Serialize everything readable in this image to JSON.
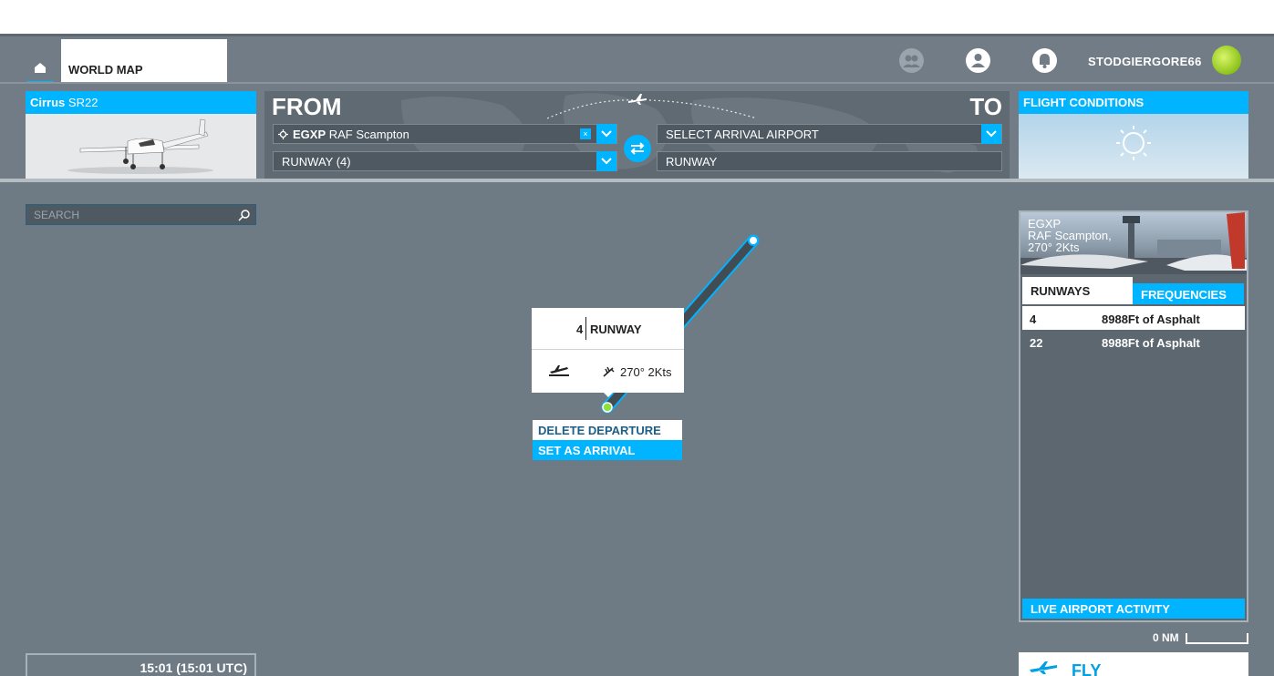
{
  "topbar": {
    "world_map_label": "WORLD MAP",
    "username": "STODGIERGORE66",
    "icons": [
      "home-icon",
      "friends-icon",
      "profile-icon",
      "notifications-icon"
    ]
  },
  "aircraft_card": {
    "name_bold": "Cirrus",
    "name_rest": " SR22"
  },
  "route": {
    "from_label": "FROM",
    "to_label": "TO",
    "departure_icao": "EGXP",
    "departure_name": " RAF Scampton",
    "departure_clear": "×",
    "departure_runway": "RUNWAY (4)",
    "arrival_placeholder": "SELECT ARRIVAL AIRPORT",
    "arrival_runway": "RUNWAY"
  },
  "conditions_card": {
    "title": "FLIGHT CONDITIONS"
  },
  "search": {
    "placeholder": "SEARCH"
  },
  "runway_popup": {
    "number": "4",
    "label": "RUNWAY",
    "wind": "270° 2Kts"
  },
  "context_menu": {
    "delete_departure": "DELETE DEPARTURE",
    "set_as_arrival": "SET AS ARRIVAL"
  },
  "airport_panel": {
    "icao": "EGXP",
    "name": "RAF Scampton,",
    "wind": "270° 2Kts",
    "tab_runways": "RUNWAYS",
    "tab_frequencies": "FREQUENCIES",
    "runways": [
      {
        "number": "4",
        "desc": "8988Ft of Asphalt"
      },
      {
        "number": "22",
        "desc": "8988Ft of Asphalt"
      }
    ],
    "live_activity": "LIVE AIRPORT ACTIVITY"
  },
  "map": {
    "scale_label": "0 NM"
  },
  "fly_button": {
    "label": "FLY"
  },
  "time": {
    "display": "15:01 (15:01 UTC)"
  },
  "colors": {
    "accent": "#00b4ff",
    "background": "#6e7a84",
    "departure_marker": "#8ee03a"
  }
}
